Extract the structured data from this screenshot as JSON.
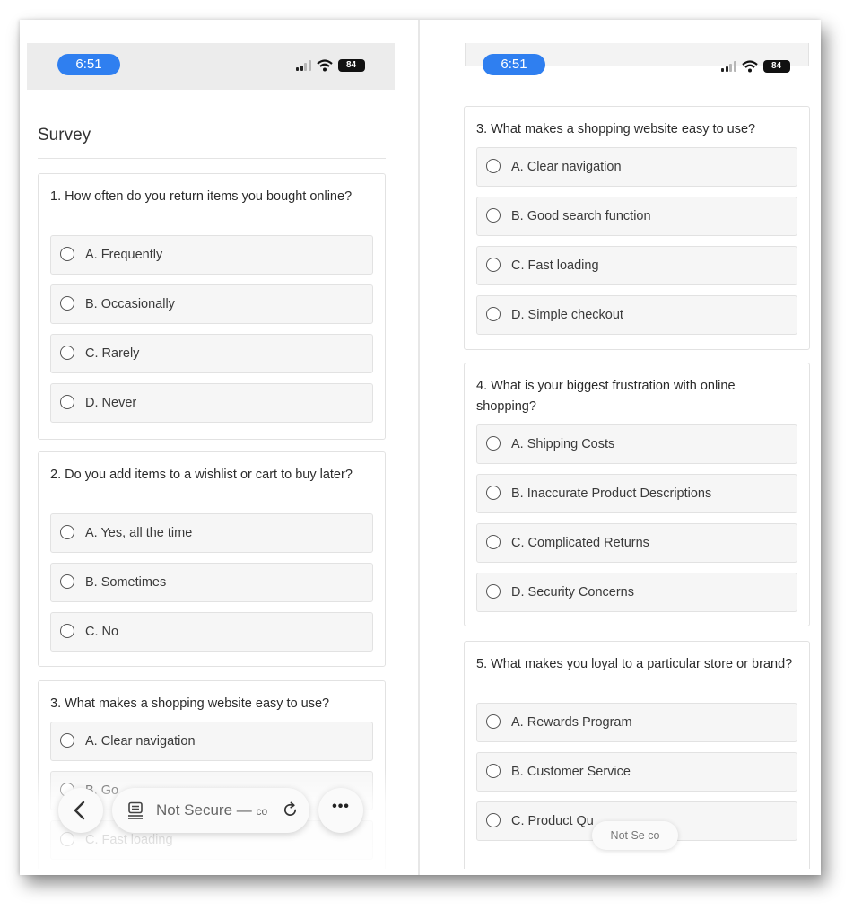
{
  "left": {
    "status": {
      "time": "6:51",
      "battery": "84"
    },
    "survey_title": "Survey",
    "questions": [
      {
        "text": "1. How often do you return items you bought online?",
        "options": [
          "A. Frequently",
          "B. Occasionally",
          "C. Rarely",
          "D. Never"
        ]
      },
      {
        "text": "2. Do you add items to a wishlist or cart to buy later?",
        "options": [
          "A. Yes, all the time",
          "B. Sometimes",
          "C. No"
        ]
      },
      {
        "text": "3. What makes a shopping website easy to use?",
        "options": [
          "A. Clear navigation",
          "B. Go",
          "C. Fast loading"
        ]
      }
    ],
    "toolbar": {
      "address": "Not Secure — ",
      "address_tail": "co",
      "more_label": "•••"
    }
  },
  "right": {
    "status": {
      "time": "6:51",
      "battery": "84"
    },
    "questions": [
      {
        "text": "3. What makes a shopping website easy to use?",
        "options": [
          "A. Clear navigation",
          "B. Good search function",
          "C. Fast loading",
          "D. Simple checkout"
        ]
      },
      {
        "text": "4. What is your biggest frustration with online shopping?",
        "options": [
          "A. Shipping Costs",
          "B. Inaccurate Product Descriptions",
          "C. Complicated Returns",
          "D. Security Concerns"
        ]
      },
      {
        "text": "5. What makes you loyal to a particular store or brand?",
        "options": [
          "A. Rewards Program",
          "B. Customer Service",
          "C. Product Qu"
        ]
      }
    ],
    "mini_address": "Not Se   co"
  }
}
